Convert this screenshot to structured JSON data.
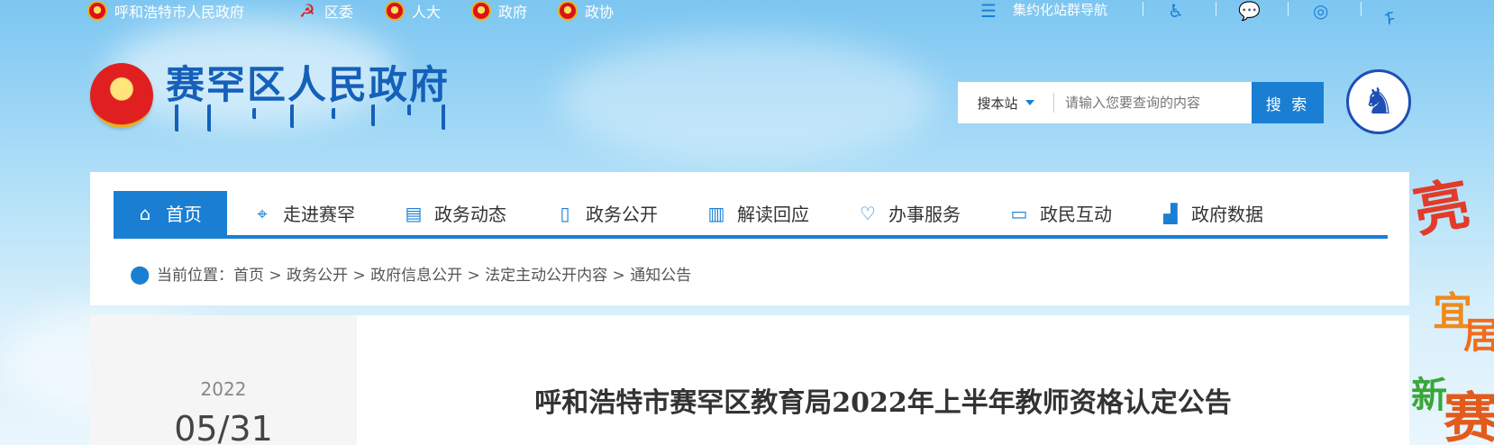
{
  "topbar": {
    "links": [
      {
        "label": "呼和浩特市人民政府"
      },
      {
        "label": "区委"
      },
      {
        "label": "人大"
      },
      {
        "label": "政府"
      },
      {
        "label": "政协"
      }
    ],
    "site_nav_label": "集约化站群导航"
  },
  "header": {
    "site_title": "赛罕区人民政府",
    "search": {
      "scope_label": "搜本站",
      "placeholder": "请输入您要查询的内容",
      "button_label": "搜 索"
    }
  },
  "nav": {
    "items": [
      {
        "label": "首页",
        "icon": "home-icon",
        "active": true
      },
      {
        "label": "走进赛罕",
        "icon": "map-pin-icon"
      },
      {
        "label": "政务动态",
        "icon": "news-icon"
      },
      {
        "label": "政务公开",
        "icon": "document-icon"
      },
      {
        "label": "解读回应",
        "icon": "book-icon"
      },
      {
        "label": "办事服务",
        "icon": "service-icon"
      },
      {
        "label": "政民互动",
        "icon": "chat-icon"
      },
      {
        "label": "政府数据",
        "icon": "chart-icon"
      }
    ]
  },
  "breadcrumb": {
    "prefix": "当前位置：",
    "path": "首页 > 政务公开 > 政府信息公开 > 法定主动公开内容 > 通知公告"
  },
  "article": {
    "year": "2022",
    "month_day": "05/31",
    "title": "呼和浩特市赛罕区教育局2022年上半年教师资格认定公告"
  },
  "decor": {
    "chars": [
      "亮",
      "宜",
      "居",
      "新",
      "赛"
    ]
  },
  "colors": {
    "accent": "#1a7fd3",
    "title_blue": "#1560b9"
  }
}
